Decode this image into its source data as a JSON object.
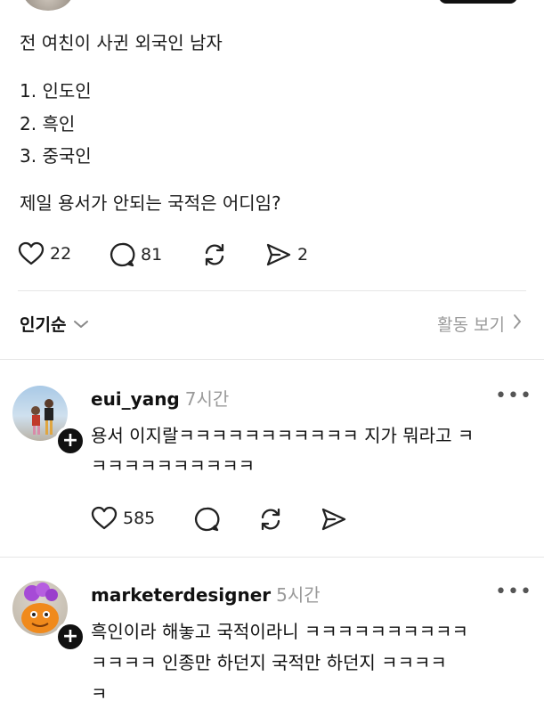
{
  "post": {
    "lines": [
      "전 여친이 사귄 외국인 남자",
      "1. 인도인",
      "2. 흑인",
      "3. 중국인",
      "제일 용서가 안되는 국적은 어디임?"
    ],
    "actions": {
      "likes": "22",
      "comments": "81",
      "shares": "2"
    }
  },
  "sort": {
    "label": "인기순",
    "activity_label": "활동 보기"
  },
  "comments": [
    {
      "username": "eui_yang",
      "time": "7시간",
      "lines": [
        "용서 이지랄ㅋㅋㅋㅋㅋㅋㅋㅋㅋㅋㅋ 지가 뭐라고 ㅋ",
        "ㅋㅋㅋㅋㅋㅋㅋㅋㅋㅋ"
      ],
      "likes": "585"
    },
    {
      "username": "marketerdesigner",
      "time": "5시간",
      "lines": [
        "흑인이라 해놓고 국적이라니 ㅋㅋㅋㅋㅋㅋㅋㅋㅋㅋ",
        "ㅋㅋㅋㅋ 인종만 하던지 국적만 하던지 ㅋㅋㅋㅋ",
        "ㅋ"
      ]
    }
  ],
  "icons": {
    "heart": "heart-icon",
    "comment": "comment-icon",
    "repost": "repost-icon",
    "share": "send-icon",
    "more": "more-icon",
    "follow": "plus-icon"
  }
}
